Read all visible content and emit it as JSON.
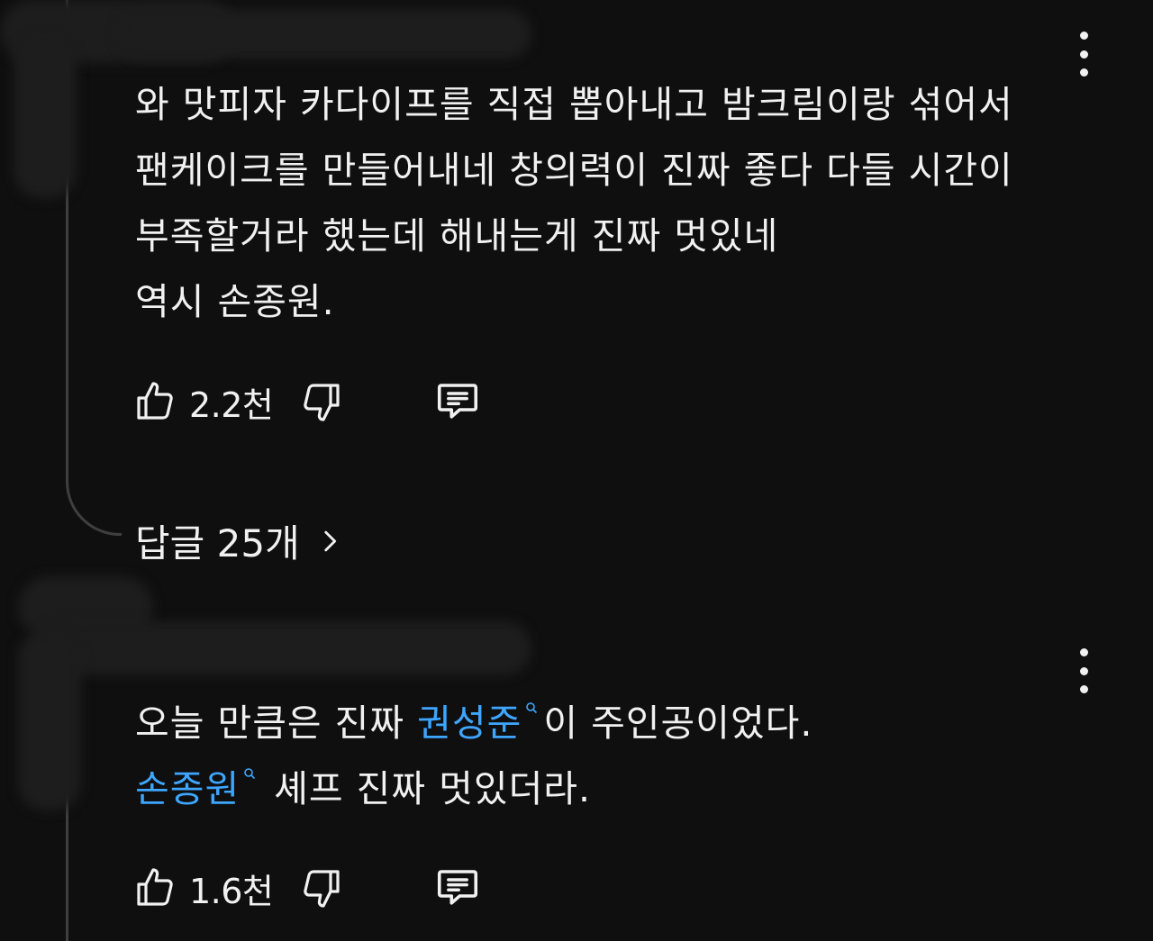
{
  "comments": [
    {
      "text_lines": [
        "와 맛피자 카다이프를 직접 뽑아내고 밤크림이랑 섞어서",
        "팬케이크를 만들어내네 창의력이 진짜 좋다 다들 시간이",
        "부족할거라 했는데 해내는게 진짜 멋있네",
        "역시 손종원."
      ],
      "likes": "2.2천",
      "replies_label": "답글 25개"
    },
    {
      "line1_before": "오늘 만큼은 진짜 ",
      "line1_mention": "권성준",
      "line1_after": "이 주인공이었다.",
      "line2_mention": "손종원",
      "line2_after": " 셰프 진짜 멋있더라.",
      "likes": "1.6천"
    }
  ],
  "icons": {
    "like": "thumbs-up-icon",
    "dislike": "thumbs-down-icon",
    "reply": "comment-icon",
    "more": "more-vert-icon",
    "chevron": "chevron-right-icon",
    "mention": "search-icon"
  },
  "colors": {
    "background": "#0f0f0f",
    "text": "#f1f1f1",
    "mention": "#3ea6ff"
  }
}
